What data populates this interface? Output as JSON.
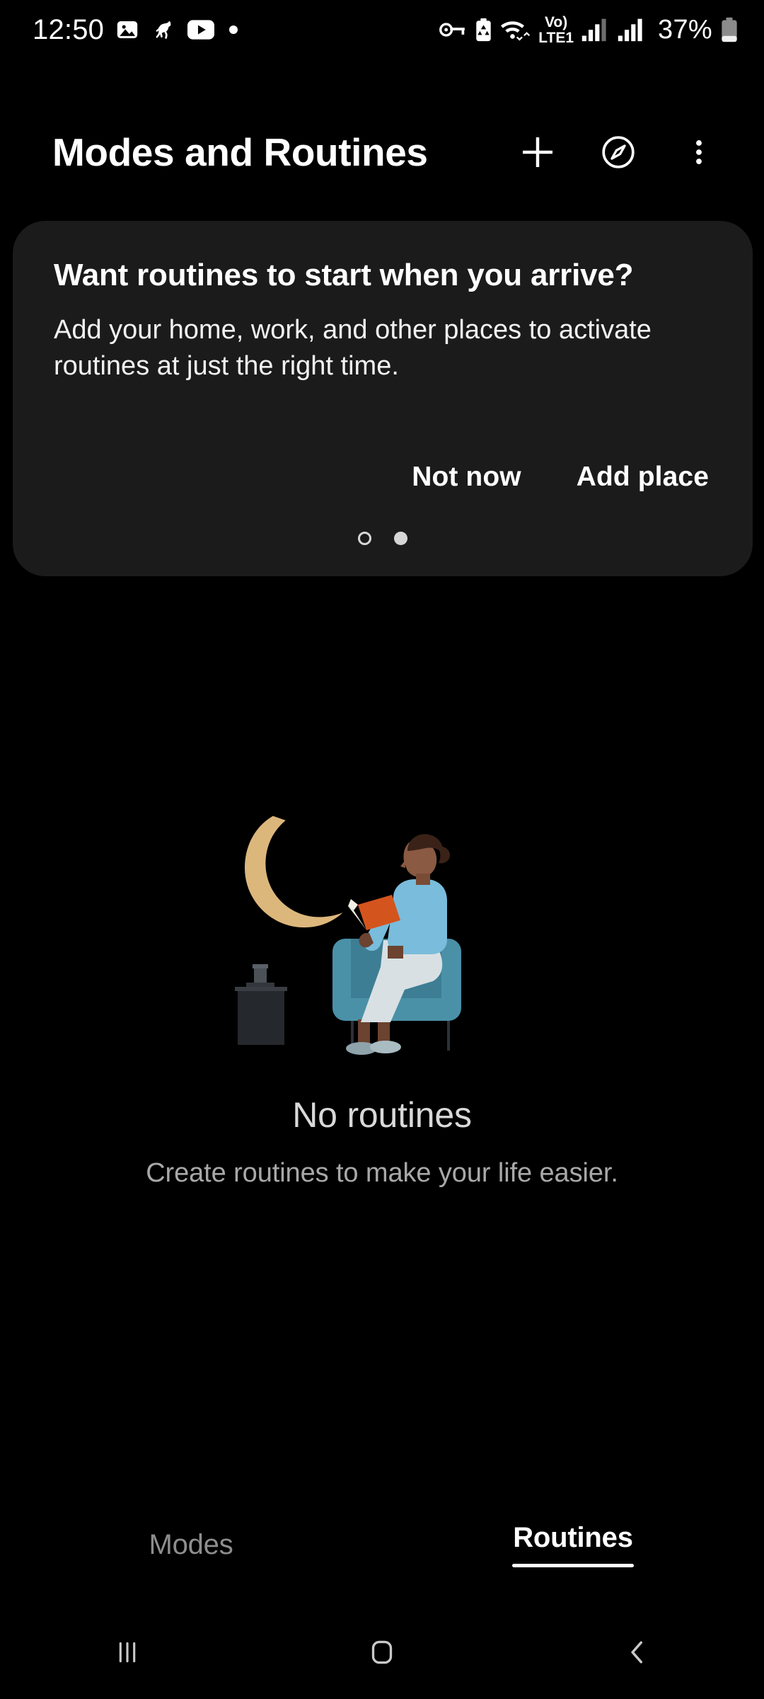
{
  "status_bar": {
    "time": "12:50",
    "left_icons": [
      "gallery-icon",
      "horse-icon",
      "youtube-icon",
      "notification-dot-icon"
    ],
    "right_icons": [
      "vpn-key-icon",
      "battery-saver-icon",
      "wifi-icon",
      "volte-icon",
      "signal-sim1-icon",
      "signal-sim2-icon",
      "battery-icon"
    ],
    "volte_label": "Vo)",
    "lte_label": "LTE1",
    "battery_percent": "37%"
  },
  "header": {
    "title": "Modes and Routines",
    "actions": [
      {
        "name": "add-button",
        "icon": "plus-icon"
      },
      {
        "name": "discover-button",
        "icon": "compass-icon"
      },
      {
        "name": "more-options-button",
        "icon": "three-dots-vertical-icon"
      }
    ]
  },
  "promo_card": {
    "title": "Want routines to start when you arrive?",
    "body": "Add your home, work, and other places to activate routines at just the right time.",
    "not_now_label": "Not now",
    "add_place_label": "Add place",
    "pager": {
      "count": 2,
      "active_index": 1
    },
    "background": "#1b1b1b"
  },
  "empty_state": {
    "illustration": "person-reading-on-armchair-at-night",
    "title": "No routines",
    "subtitle": "Create routines to make your life easier.",
    "colors": {
      "moon": "#dcb77c",
      "chair_outer": "#4a91a8",
      "chair_inner": "#3d7e94",
      "sweater": "#79bcdb",
      "pants": "#d8e0e3",
      "skin": "#8a5a42",
      "hair": "#3a2218",
      "book": "#d4541e",
      "table": "#292c31",
      "lamp": "#4c5158",
      "shoes": "#8fa3ab"
    }
  },
  "bottom_tabs": {
    "items": [
      {
        "label": "Modes",
        "active": false
      },
      {
        "label": "Routines",
        "active": true
      }
    ]
  },
  "nav_bar": {
    "buttons": [
      {
        "name": "recents-button",
        "icon": "recents-icon"
      },
      {
        "name": "home-button",
        "icon": "home-icon"
      },
      {
        "name": "back-button",
        "icon": "back-chevron-icon"
      }
    ]
  }
}
